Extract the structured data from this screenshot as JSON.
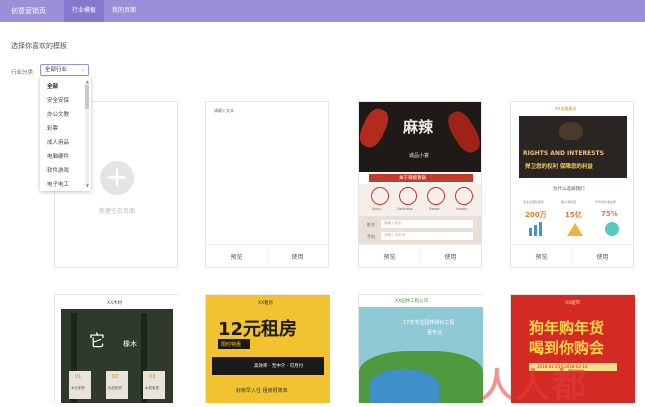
{
  "app": {
    "brand": "创意营销页"
  },
  "nav": {
    "tabs": [
      {
        "label": "行业模板",
        "active": true
      },
      {
        "label": "我的页面",
        "active": false
      }
    ]
  },
  "main": {
    "heading": "选择你喜欢的模板",
    "filter_label": "行业分类",
    "select_value": "全部行业"
  },
  "dropdown": {
    "options": [
      "全部",
      "安全安保",
      "办公文教",
      "彩票",
      "成人用品",
      "电脑硬件",
      "软件游戏",
      "电子电工"
    ]
  },
  "cards": {
    "new_label": "新建空白页面",
    "blank_tag": "请输入文本",
    "preview": "预览",
    "use": "使用"
  },
  "templates": {
    "t1": {
      "title": "麻辣",
      "sub": "诚品小宴",
      "band": "关于辣椒香锅",
      "labels": [
        "Spicy",
        "Delicious",
        "Sweet",
        "Honey"
      ],
      "f1": "姓名",
      "f1ph": "请输入姓名",
      "f2": "手机",
      "f2ph": "请输入手机号"
    },
    "t2": {
      "brand": "XX金融服务",
      "h1": "RIGHTS AND INTERESTS",
      "h2": "捍卫您的权利 保障您的利益",
      "q": "为什么选择我们",
      "cols": [
        "专业化团队服务",
        "客户满意度",
        "平均年化收益率"
      ],
      "nums": [
        "200万",
        "15亿",
        "75%"
      ]
    },
    "t3": {
      "brand": "XX木材",
      "char": "它",
      "word": "橡木",
      "steps": [
        "01",
        "02",
        "03"
      ],
      "step_labels": [
        "木业制作",
        "优品制作",
        "木质家居"
      ]
    },
    "t4": {
      "brand": "XX租房",
      "big": "12元租房",
      "sub": "限时特惠",
      "tag": "高效率 · 无中介 · 可月付",
      "foot": "好房早入住 租房很简单"
    },
    "t5": {
      "brand": "XX园林工程公司",
      "l1": "17年专注园林绿化工程",
      "l2": "更专业"
    },
    "t6": {
      "brand": "XX超市",
      "l1": "狗年购年货",
      "l2": "喝到你购会",
      "foot": "2018-01-25至2018-02-10"
    }
  },
  "watermark": "人人都"
}
